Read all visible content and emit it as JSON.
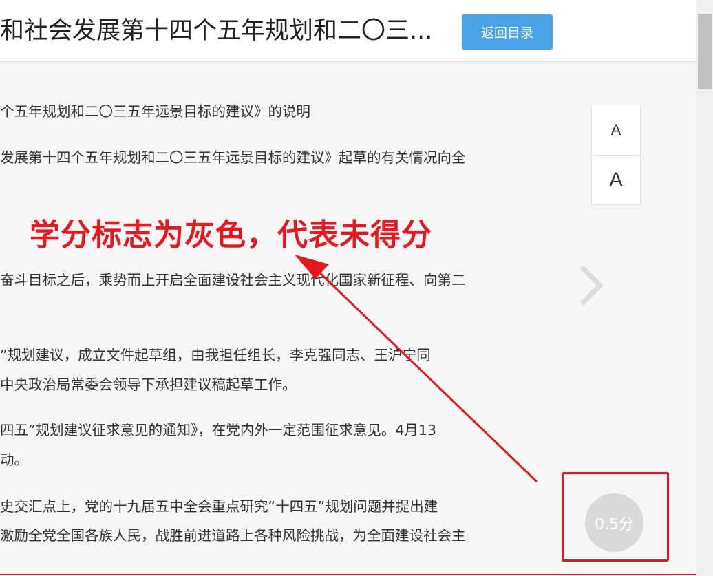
{
  "header": {
    "title": "和社会发展第十四个五年规划和二〇三...",
    "back_button_label": "返回目录"
  },
  "paragraphs": [
    "个五年规划和二〇三五年远景目标的建议》的说明",
    "发展第十四个五年规划和二〇三五年远景目标的建议》起草的有关情况向全",
    "奋斗目标之后，乘势而上开启全面建设社会主义现代化国家新征程、向第二",
    "”规划建议，成立文件起草组，由我担任组长，李克强同志、王沪宁同",
    "中央政治局常委会领导下承担建议稿起草工作。",
    "四五”规划建议征求意见的通知》，在党内外一定范围征求意见。4月13",
    "动。",
    "史交汇点上，党的十九届五中全会重点研究“十四五”规划问题并提出建",
    "激励全党全国各族人民，战胜前进道路上各种风险挑战，为全面建设社会主"
  ],
  "font_controls": {
    "decrease_label": "A",
    "increase_label": "A"
  },
  "annotation": {
    "text": "学分标志为灰色，代表未得分",
    "color": "#e5171f"
  },
  "score": {
    "label": "0.5分",
    "badge_color": "#d9d9d9"
  },
  "colors": {
    "accent": "#4aa3e7",
    "annotation_red": "#e5171f"
  },
  "icons": {
    "next": "chevron-right-icon"
  }
}
